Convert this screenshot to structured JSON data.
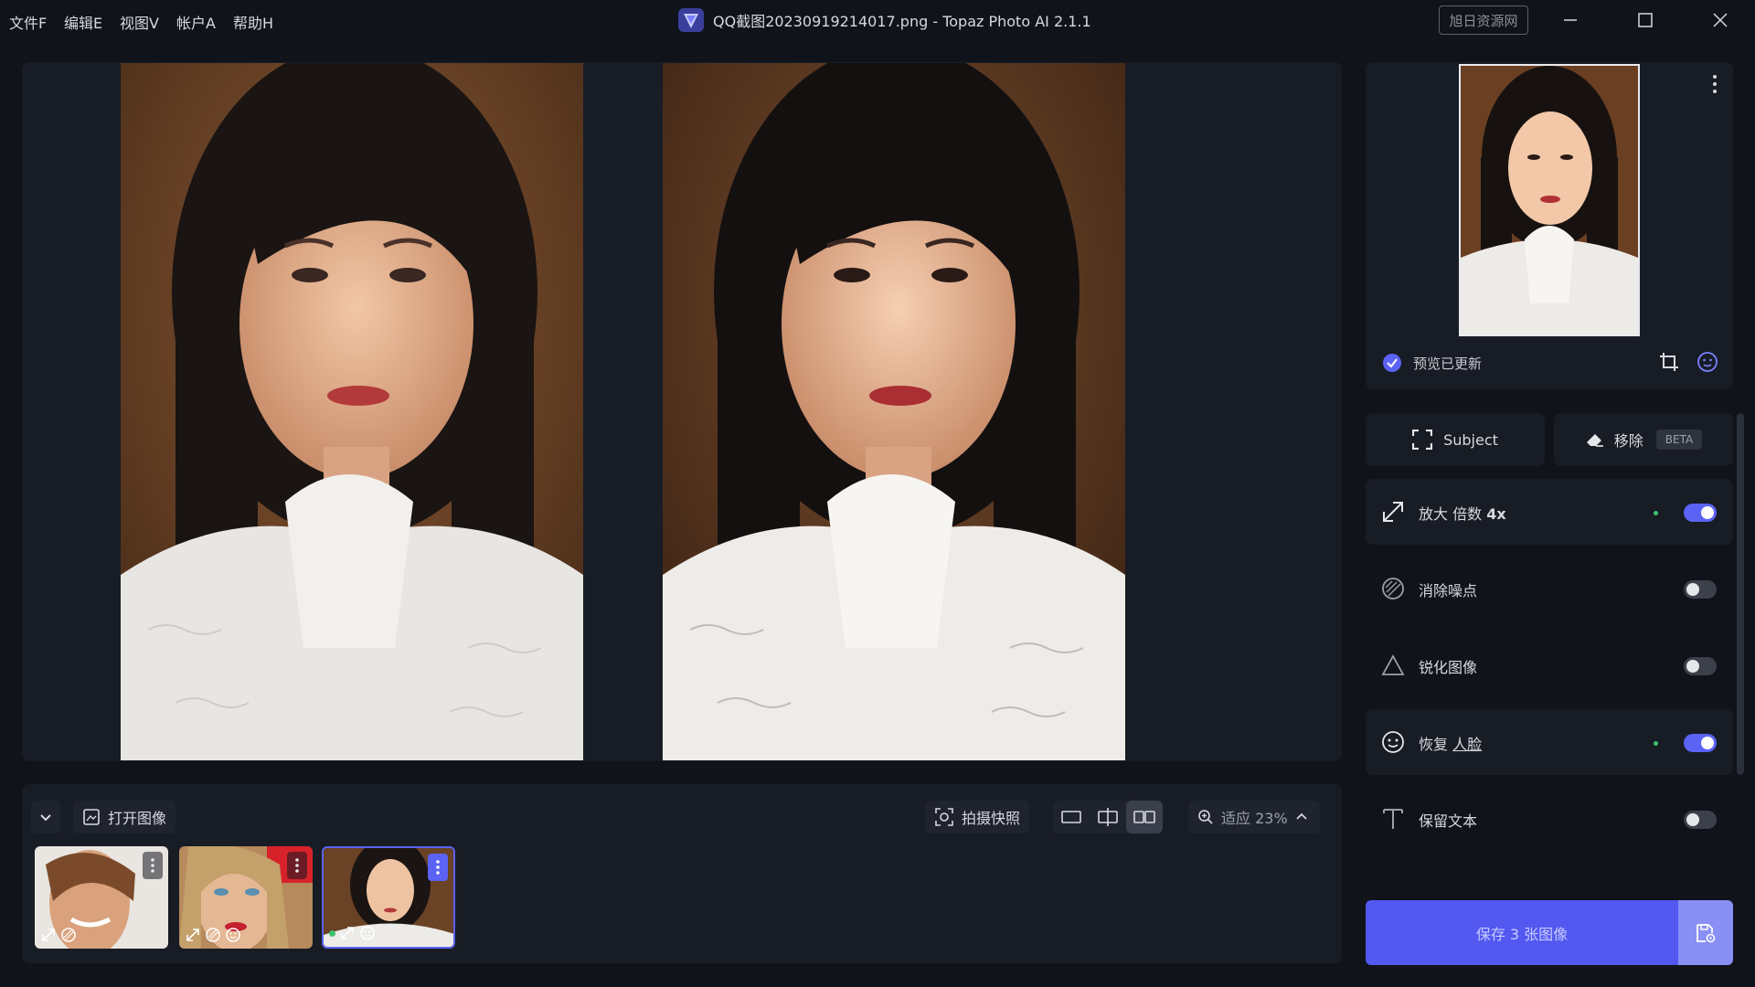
{
  "menu": {
    "file": "文件F",
    "edit": "编辑E",
    "view": "视图V",
    "account": "帐户A",
    "help": "帮助H"
  },
  "window": {
    "title": "QQ截图20230919214017.png - Topaz Photo AI 2.1.1",
    "watermark": "旭日资源网"
  },
  "preview_panel": {
    "status": "预览已更新"
  },
  "tools": {
    "subject": "Subject",
    "remove": "移除",
    "remove_badge": "BETA"
  },
  "enhancements": {
    "upscale": {
      "label": "放大 倍数",
      "value": "4x",
      "enabled": true
    },
    "denoise": {
      "label": "消除噪点",
      "enabled": false
    },
    "sharpen": {
      "label": "锐化图像",
      "enabled": false
    },
    "face_recovery": {
      "label": "恢复",
      "label_link": "人脸",
      "enabled": true
    },
    "preserve_text": {
      "label": "保留文本",
      "enabled": false
    }
  },
  "bottombar": {
    "open_image": "打开图像",
    "snapshot": "拍摄快照",
    "zoom": "适应 23%"
  },
  "save": {
    "label": "保存 3 张图像"
  },
  "colors": {
    "accent": "#5b63f5",
    "active_dot": "#3ec26b",
    "background": "#10131a",
    "panel": "#181c25"
  }
}
